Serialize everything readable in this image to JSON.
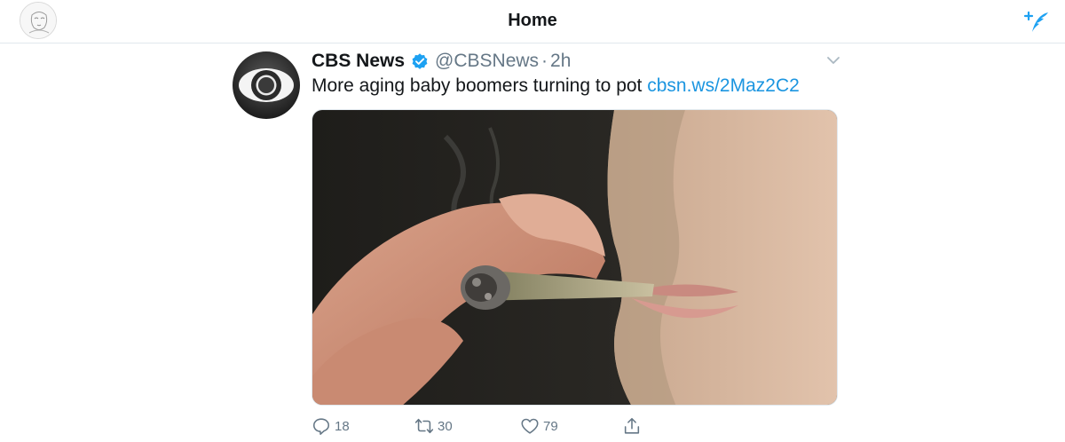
{
  "header": {
    "title": "Home",
    "avatar_icon": "user-avatar-icon",
    "compose_icon": "compose-tweet-icon"
  },
  "tweet": {
    "author_name": "CBS News",
    "handle": "@CBSNews",
    "separator": "·",
    "time": "2h",
    "verified_icon": "verified-badge-icon",
    "text": "More aging baby boomers turning to pot ",
    "link": "cbsn.ws/2Maz2C2",
    "media_description_icon": "photo-image",
    "actions": {
      "reply_count": "18",
      "retweet_count": "30",
      "like_count": "79"
    }
  },
  "colors": {
    "accent": "#1b95e0",
    "secondary_text": "#657786",
    "divider": "#e1e8ed"
  }
}
